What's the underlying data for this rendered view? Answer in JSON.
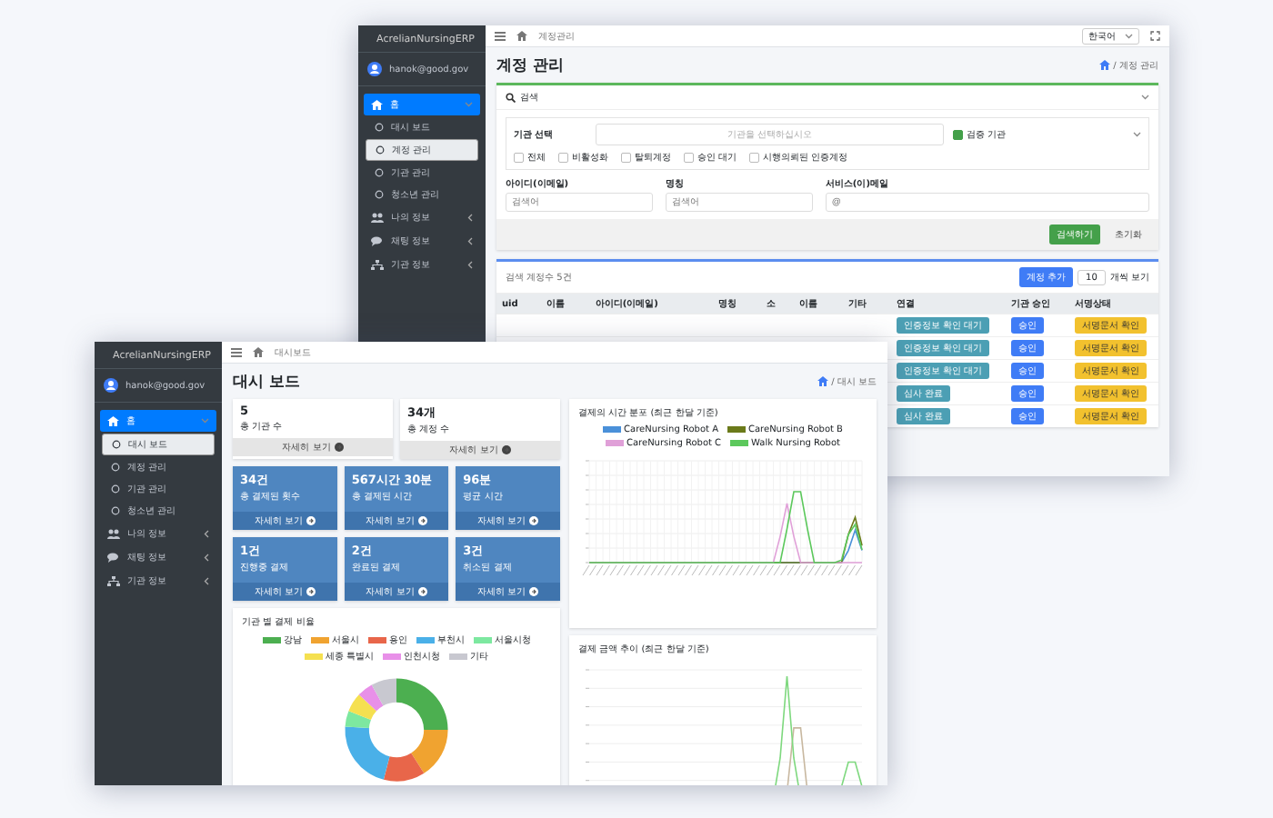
{
  "windows": [
    {
      "kind": "accounts",
      "sidebar": {
        "brand": "AcrelianNursingERP",
        "user": "hanok@good.gov",
        "menu": [
          {
            "label": "홈",
            "selected": true,
            "expanded": true,
            "children": [
              {
                "label": "대시 보드",
                "selected": false
              },
              {
                "label": "계정 관리",
                "selected": true
              },
              {
                "label": "기관 관리",
                "selected": false
              },
              {
                "label": "청소년 관리",
                "selected": false
              }
            ]
          },
          {
            "label": "나의 정보",
            "selected": false,
            "expanded": false
          },
          {
            "label": "채팅 정보",
            "selected": false,
            "expanded": false
          },
          {
            "label": "기관 정보",
            "selected": false,
            "expanded": false
          }
        ]
      },
      "topbar": {
        "breadcrumb": "계정관리",
        "language": "한국어"
      },
      "title": "계정 관리",
      "path": "/ 계정 관리",
      "search": {
        "title": "검색",
        "org_label": "기관 선택",
        "org_placeholder": "기관을 선택하십시오",
        "verified": {
          "label": "검증 기관",
          "checked": true
        },
        "filters": [
          {
            "label": "전체",
            "checked": false
          },
          {
            "label": "비활성화",
            "checked": false
          },
          {
            "label": "탈퇴계정",
            "checked": false
          },
          {
            "label": "승인 대기",
            "checked": false
          },
          {
            "label": "시행의뢰된 인증계정",
            "checked": false
          }
        ],
        "fields": [
          {
            "label": "아이디(이메일)",
            "placeholder": "검색어"
          },
          {
            "label": "명칭",
            "placeholder": "검색어"
          },
          {
            "label": "서비스(이)메일",
            "placeholder": "@"
          }
        ],
        "buttons": [
          "검색하기",
          "초기화"
        ]
      },
      "table": {
        "count": "검색 계정수 5건",
        "add": "계정 추가",
        "page_size": "10",
        "page_label": "개씩 보기",
        "columns": [
          "uid",
          "이름",
          "아이디(이메일)",
          "명칭",
          "소",
          "이름",
          "기타",
          "연결",
          "기관 승인",
          "서명상태"
        ],
        "rows": [
          {
            "badges": [
              {
                "kind": "info",
                "label": "인증정보 확인 대기"
              },
              {
                "kind": "primary",
                "label": "승인"
              },
              {
                "kind": "warning",
                "label": "서명문서 확인"
              }
            ]
          },
          {
            "badges": [
              {
                "kind": "info",
                "label": "인증정보 확인 대기"
              },
              {
                "kind": "primary",
                "label": "승인"
              },
              {
                "kind": "warning",
                "label": "서명문서 확인"
              }
            ]
          },
          {
            "badges": [
              {
                "kind": "info",
                "label": "인증정보 확인 대기"
              },
              {
                "kind": "primary",
                "label": "승인"
              },
              {
                "kind": "warning",
                "label": "서명문서 확인"
              }
            ]
          },
          {
            "badges": [
              {
                "kind": "info",
                "label": "심사 완료"
              },
              {
                "kind": "primary",
                "label": "승인"
              },
              {
                "kind": "warning",
                "label": "서명문서 확인"
              }
            ]
          },
          {
            "badges": [
              {
                "kind": "info",
                "label": "심사 완료"
              },
              {
                "kind": "primary",
                "label": "승인"
              },
              {
                "kind": "warning",
                "label": "서명문서 확인"
              }
            ]
          }
        ]
      }
    },
    {
      "kind": "dashboard",
      "sidebar": {
        "brand": "AcrelianNursingERP",
        "user": "hanok@good.gov",
        "menu": [
          {
            "label": "홈",
            "selected": true,
            "expanded": true,
            "children": [
              {
                "label": "대시 보드",
                "selected": true
              },
              {
                "label": "계정 관리",
                "selected": false
              },
              {
                "label": "기관 관리",
                "selected": false
              },
              {
                "label": "청소년 관리",
                "selected": false
              }
            ]
          },
          {
            "label": "나의 정보",
            "selected": false,
            "expanded": false
          },
          {
            "label": "채팅 정보",
            "selected": false,
            "expanded": false
          },
          {
            "label": "기관 정보",
            "selected": false,
            "expanded": false
          }
        ]
      },
      "topbar": {
        "breadcrumb": "대시보드"
      },
      "title": "대시 보드",
      "path": "/ 대시 보드",
      "summary": [
        {
          "value": "5",
          "label": "총 기관 수",
          "more": "자세히 보기"
        },
        {
          "value": "34개",
          "label": "총 계정 수",
          "more": "자세히 보기"
        }
      ],
      "stats": [
        {
          "value": "34건",
          "label": "총 결제된 횟수",
          "more": "자세히 보기"
        },
        {
          "value": "567시간 30분",
          "label": "총 결제된 시간",
          "more": "자세히 보기"
        },
        {
          "value": "96분",
          "label": "평균 시간",
          "more": "자세히 보기"
        },
        {
          "value": "1건",
          "label": "진행중 결제",
          "more": "자세히 보기"
        },
        {
          "value": "2건",
          "label": "완료된 결제",
          "more": "자세히 보기"
        },
        {
          "value": "3건",
          "label": "취소된 결제",
          "more": "자세히 보기"
        }
      ],
      "donut": {
        "title": "기관 별 결제 비율",
        "legend": [
          {
            "label": "강남",
            "color": "#4caf50"
          },
          {
            "label": "서울시",
            "color": "#f0a330"
          },
          {
            "label": "용인",
            "color": "#e8664a"
          },
          {
            "label": "부천시",
            "color": "#4ab0e8"
          },
          {
            "label": "서울시청",
            "color": "#7de8a0"
          },
          {
            "label": "세종 특별시",
            "color": "#f5e050"
          },
          {
            "label": "인천시청",
            "color": "#e890e8"
          },
          {
            "label": "기타",
            "color": "#c8c8d0"
          }
        ]
      },
      "charts": [
        {
          "title": "결제의 시간 분포 (최근 한달 기준)",
          "legend": [
            {
              "label": "CareNursing Robot A",
              "color": "#4a90d9"
            },
            {
              "label": "CareNursing Robot B",
              "color": "#6b7a1a"
            },
            {
              "label": "CareNursing Robot C",
              "color": "#e0a0d8"
            },
            {
              "label": "Walk Nursing Robot",
              "color": "#5cc85c"
            }
          ]
        },
        {
          "title": "결제 금액 추이 (최근 한달 기준)"
        }
      ]
    }
  ]
}
